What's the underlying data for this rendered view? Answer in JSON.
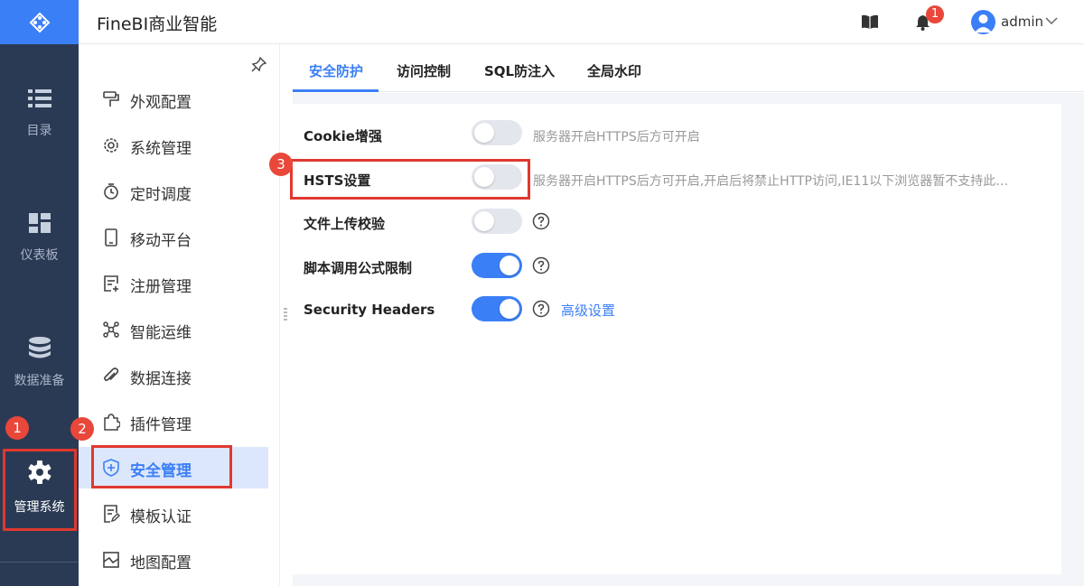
{
  "app": {
    "title": "FineBI商业智能"
  },
  "leftnav": {
    "items": [
      {
        "label": "目录",
        "icon": "list-icon"
      },
      {
        "label": "仪表板",
        "icon": "dashboard-icon"
      },
      {
        "label": "数据准备",
        "icon": "database-icon"
      },
      {
        "label": "管理系统",
        "icon": "gear-icon",
        "active": true
      }
    ]
  },
  "header": {
    "notification_count": "1",
    "user": "admin"
  },
  "subnav": {
    "items": [
      {
        "label": "外观配置",
        "icon": "paint-roller-icon"
      },
      {
        "label": "系统管理",
        "icon": "settings-icon"
      },
      {
        "label": "定时调度",
        "icon": "timer-icon"
      },
      {
        "label": "移动平台",
        "icon": "mobile-icon"
      },
      {
        "label": "注册管理",
        "icon": "register-icon"
      },
      {
        "label": "智能运维",
        "icon": "network-icon"
      },
      {
        "label": "数据连接",
        "icon": "attachment-icon"
      },
      {
        "label": "插件管理",
        "icon": "puzzle-icon"
      },
      {
        "label": "安全管理",
        "icon": "shield-icon",
        "active": true
      },
      {
        "label": "模板认证",
        "icon": "doc-edit-icon"
      },
      {
        "label": "地图配置",
        "icon": "map-icon"
      }
    ]
  },
  "tabs": [
    {
      "label": "安全防护",
      "active": true
    },
    {
      "label": "访问控制"
    },
    {
      "label": "SQL防注入"
    },
    {
      "label": "全局水印"
    }
  ],
  "settings": [
    {
      "label": "Cookie增强",
      "enabled": false,
      "desc": "服务器开启HTTPS后方可开启"
    },
    {
      "label": "HSTS设置",
      "enabled": false,
      "desc": "服务器开启HTTPS后方可开启,开启后将禁止HTTP访问,IE11以下浏览器暂不支持此…"
    },
    {
      "label": "文件上传校验",
      "enabled": false
    },
    {
      "label": "脚本调用公式限制",
      "enabled": true
    },
    {
      "label": "Security Headers",
      "enabled": true,
      "link": "高级设置"
    }
  ],
  "annotations": [
    "1",
    "2",
    "3"
  ],
  "colors": {
    "accent": "#3b7ff6",
    "nav_bg": "#2b3a54",
    "highlight": "#e0382f"
  }
}
